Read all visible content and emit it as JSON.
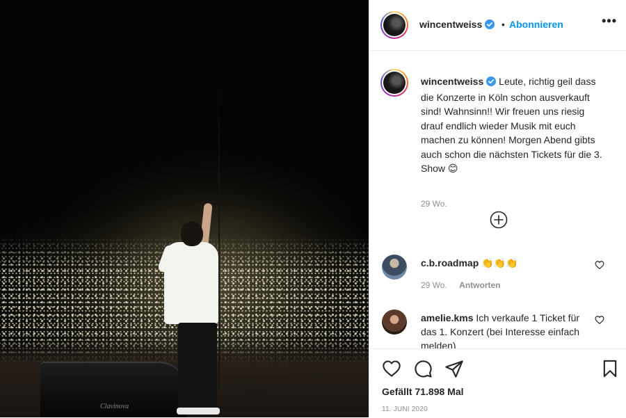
{
  "post": {
    "media": {
      "piano_brand": "Clavinova"
    },
    "header": {
      "username": "wincentweiss",
      "separator": "•",
      "follow_label": "Abonnieren",
      "more_icon": "more-options-icon",
      "more_glyph": "•••"
    },
    "caption": {
      "username": "wincentweiss",
      "text": "Leute, richtig geil dass die Konzerte in Köln schon ausverkauft sind! Wahnsinn!! Wir freuen uns riesig drauf endlich wieder Musik mit euch machen zu können! Morgen Abend gibts auch schon die nächsten Tickets für die 3. Show 😊",
      "time": "29 Wo."
    },
    "load_more_icon": "plus-circle-icon",
    "comments": [
      {
        "username": "c.b.roadmap",
        "text": "👏👏👏",
        "time": "29 Wo.",
        "reply_label": "Antworten"
      },
      {
        "username": "amelie.kms",
        "text": "Ich verkaufe 1 Ticket für das 1. Konzert (bei Interesse einfach melden)"
      }
    ],
    "actions": {
      "likes": "Gefällt 71.898 Mal",
      "date": "11. JUNI 2020"
    },
    "colors": {
      "link_blue": "#0095f6",
      "verified_blue": "#3897f0",
      "muted": "#8e8e8e",
      "text": "#262626"
    }
  }
}
